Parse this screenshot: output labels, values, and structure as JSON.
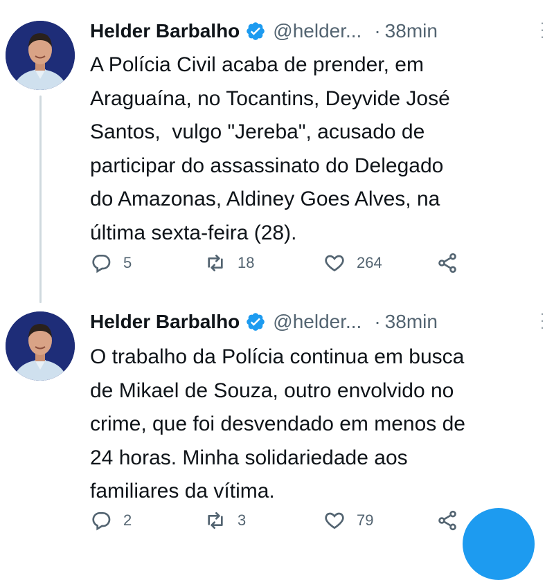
{
  "colors": {
    "text": "#0f1419",
    "secondary": "#536471",
    "verified": "#1d9bf0",
    "thread_line": "#cfd9de",
    "fab": "#1d9bf0"
  },
  "tweets": [
    {
      "author_name": "Helder Barbalho",
      "handle": "@helder...",
      "separator": "·",
      "time": "38min",
      "text": "A Polícia Civil acaba de prender, em\nAraguaína, no Tocantins, Deyvide José\nSantos,  vulgo \"Jereba\", acusado de\nparticipar do assassinato do Delegado\ndo Amazonas, Aldiney Goes Alves, na\núltima sexta-feira (28).",
      "replies": "5",
      "retweets": "18",
      "likes": "264"
    },
    {
      "author_name": "Helder Barbalho",
      "handle": "@helder...",
      "separator": "·",
      "time": "38min",
      "text": "O trabalho da Polícia continua em busca\nde Mikael de Souza, outro envolvido no\ncrime, que foi desvendado em menos de\n24 horas. Minha solidariedade aos\nfamiliares da vítima.",
      "replies": "2",
      "retweets": "3",
      "likes": "79"
    }
  ],
  "icons": {
    "avatar": "avatar-photo",
    "verified": "verified-badge-icon",
    "more": "more-vertical-icon",
    "reply": "reply-icon",
    "retweet": "retweet-icon",
    "like": "heart-icon",
    "share": "share-icon",
    "fab": "compose-fab"
  }
}
